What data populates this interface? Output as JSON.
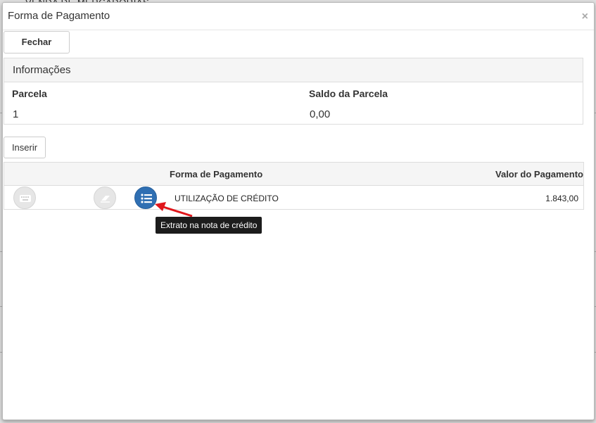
{
  "background": {
    "partial_text": "VENDA DE MERCADORIAS"
  },
  "modal": {
    "title": "Forma de Pagamento",
    "close_symbol": "×",
    "close_label": "Fechar"
  },
  "info": {
    "heading": "Informações",
    "parcela_label": "Parcela",
    "parcela_value": "1",
    "saldo_label": "Saldo da Parcela",
    "saldo_value": "0,00"
  },
  "insert_label": "Inserir",
  "grid": {
    "columns": [
      "Forma de Pagamento",
      "Valor do Pagamento"
    ],
    "rows": [
      {
        "forma": "UTILIZAÇÃO DE CRÉDITO",
        "valor": "1.843,00",
        "actions": [
          {
            "icon": "keyboard-icon",
            "enabled": false
          },
          {
            "icon": "eraser-icon",
            "enabled": false
          },
          {
            "icon": "list-icon",
            "enabled": true
          }
        ]
      }
    ]
  },
  "tooltip": "Extrato na nota de crédito",
  "colors": {
    "primary": "#2f6fb3",
    "annotation_arrow": "#e0161b",
    "tooltip_bg": "#1c1c1c"
  }
}
